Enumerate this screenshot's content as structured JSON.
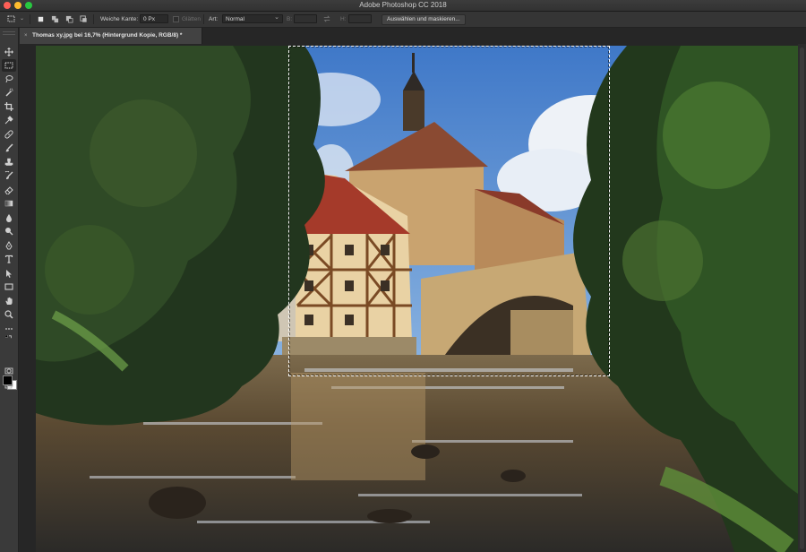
{
  "window": {
    "title": "Adobe Photoshop CC 2018"
  },
  "options_bar": {
    "feather_label": "Weiche Kante:",
    "feather_value": "0 Px",
    "smooth_label": "Glätten",
    "style_label": "Art:",
    "style_value": "Normal",
    "width_label": "B:",
    "height_label": "H:",
    "select_mask_button": "Auswählen und maskieren..."
  },
  "document_tab": {
    "close_glyph": "×",
    "title": "Thomas xy.jpg bei 16,7% (Hintergrund Kopie, RGB/8) *"
  },
  "tools": [
    "move-tool",
    "rectangular-marquee-tool",
    "lasso-tool",
    "quick-selection-tool",
    "crop-tool",
    "eyedropper-tool",
    "healing-brush-tool",
    "brush-tool",
    "clone-stamp-tool",
    "history-brush-tool",
    "eraser-tool",
    "gradient-tool",
    "blur-tool",
    "dodge-tool",
    "pen-tool",
    "type-tool",
    "path-selection-tool",
    "rectangle-tool",
    "hand-tool",
    "zoom-tool",
    "edit-toolbar",
    "swap-colors",
    "quick-mask",
    "screen-mode"
  ],
  "colors": {
    "foreground": "#000000",
    "background": "#ffffff",
    "accent_close": "#fe5f57",
    "accent_min": "#febc2e",
    "accent_max": "#28c840"
  }
}
